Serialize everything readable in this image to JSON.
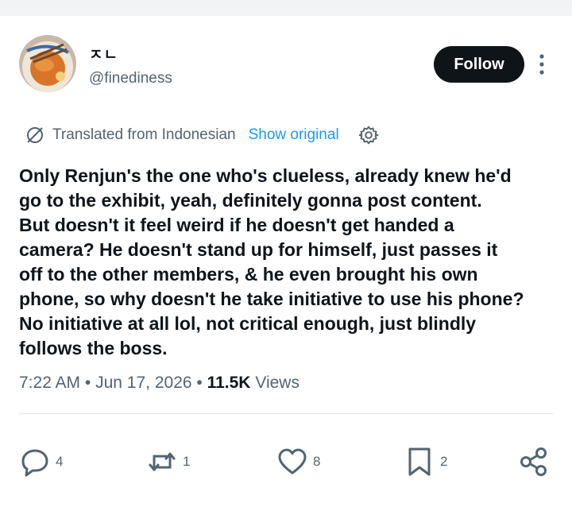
{
  "author": {
    "display_name": "ㅈㄴ",
    "handle": "@finediness"
  },
  "follow_label": "Follow",
  "translation": {
    "label": "Translated from Indonesian",
    "show_original": "Show original"
  },
  "post_text": "Only Renjun's the one who's clueless, already knew he'd\ngo to the exhibit, yeah, definitely gonna post content.\nBut doesn't it feel weird if he doesn't get handed a\ncamera? He doesn't stand up for himself, just passes it\noff to the other members, & he even brought his own\nphone, so why doesn't he take initiative to use his phone?\nNo initiative at all lol, not critical enough, just blindly\nfollows the boss.",
  "meta": {
    "time": "7:22 AM",
    "date": "Jun 17, 2026",
    "views_count": "11.5K",
    "views_label": "Views",
    "separator": "•"
  },
  "actions": {
    "replies": "4",
    "reposts": "1",
    "likes": "8",
    "bookmarks": "2"
  },
  "colors": {
    "text": "#0f1419",
    "muted": "#536471",
    "accent": "#1d9bf0",
    "divider": "#e3e6e8"
  },
  "icons": [
    "globe-slash-icon",
    "gear-icon",
    "reply-icon",
    "repost-icon",
    "like-icon",
    "bookmark-icon",
    "share-icon",
    "more-icon"
  ]
}
